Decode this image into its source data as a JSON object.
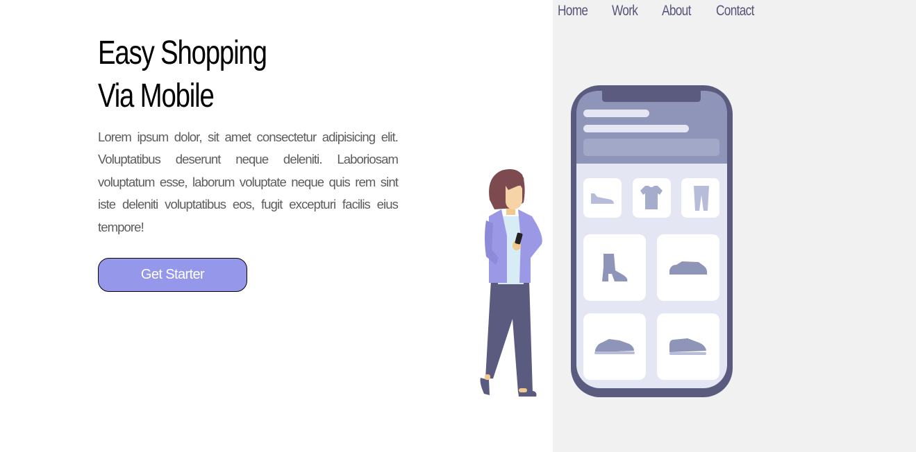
{
  "nav": {
    "items": [
      {
        "label": "Home"
      },
      {
        "label": "Work"
      },
      {
        "label": "About"
      },
      {
        "label": "Contact"
      }
    ]
  },
  "hero": {
    "title_line1": "Easy Shopping",
    "title_line2": "Via Mobile",
    "description": "Lorem ipsum dolor, sit amet consectetur adipisicing elit. Voluptatibus deserunt neque deleniti. Laboriosam voluptatum esse, laborum voluptate neque quis rem sint iste deleniti voluptatibus eos, fugit excepturi facilis eius tempore!",
    "cta_label": "Get Starter"
  },
  "colors": {
    "accent": "#9598ea",
    "panel_bg": "#f1f1f1",
    "nav_text": "#55557a",
    "phone_frame": "#5b5b80",
    "phone_header": "#8f95b8",
    "phone_screen": "#e4e6f3",
    "product_icon": "#8f95b8"
  },
  "illustration": {
    "products": [
      "shoe-icon",
      "tshirt-icon",
      "pants-icon",
      "boot-icon",
      "sneaker-icon",
      "sneaker-icon",
      "sneaker-icon"
    ]
  }
}
